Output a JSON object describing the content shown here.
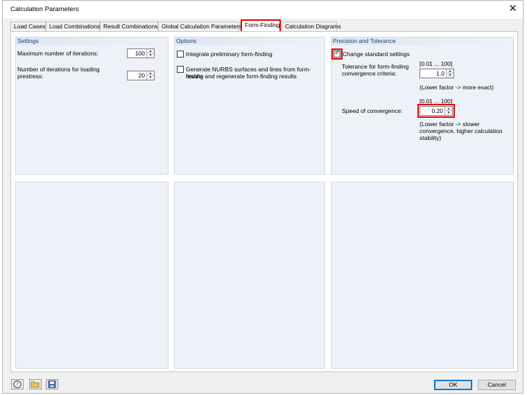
{
  "window": {
    "title": "Calculation Parameters",
    "close_glyph": "✕"
  },
  "tabs": [
    {
      "label": "Load Cases"
    },
    {
      "label": "Load Combinations"
    },
    {
      "label": "Result Combinations"
    },
    {
      "label": "Global Calculation Parameters"
    },
    {
      "label": "Form-Finding",
      "active": true
    },
    {
      "label": "Calculation Diagrams"
    }
  ],
  "settings": {
    "title": "Settings",
    "max_iterations_label": "Maximum number of iterations:",
    "max_iterations_value": "100",
    "loading_iterations_label_1": "Number of iterations for loading",
    "loading_iterations_label_2": "prestress:",
    "loading_iterations_value": "20"
  },
  "options": {
    "title": "Options",
    "integrate_label": "Integrate preliminary form-finding",
    "integrate_checked": false,
    "nurbs_label_1": "Generate NURBS surfaces and lines from form-finding",
    "nurbs_label_2": "results and regenerate form-finding results",
    "nurbs_checked": false
  },
  "precision": {
    "title": "Precision and Tolerance",
    "change_label": "Change standard settings",
    "change_checked": true,
    "tolerance_range": "[0.01 ... 100]",
    "tolerance_label_1": "Tolerance for form-finding",
    "tolerance_label_2": "convergence criteria:",
    "tolerance_value": "1.0",
    "tolerance_hint": "(Lower factor -> more exact)",
    "speed_range": "[0.01 ... 100]",
    "speed_label": "Speed of convergence:",
    "speed_value": "0.20",
    "speed_hint_1": "(Lower factor -> slower",
    "speed_hint_2": "convergence, higher calculation",
    "speed_hint_3": "stability)"
  },
  "icons": {
    "help": "help-icon",
    "open": "open-folder-icon",
    "save": "save-icon"
  },
  "buttons": {
    "ok": "OK",
    "cancel": "Cancel"
  },
  "colors": {
    "highlight": "#e00000",
    "panel_head_text": "#1a3f7a",
    "panel_bg": "#eef1f7"
  }
}
